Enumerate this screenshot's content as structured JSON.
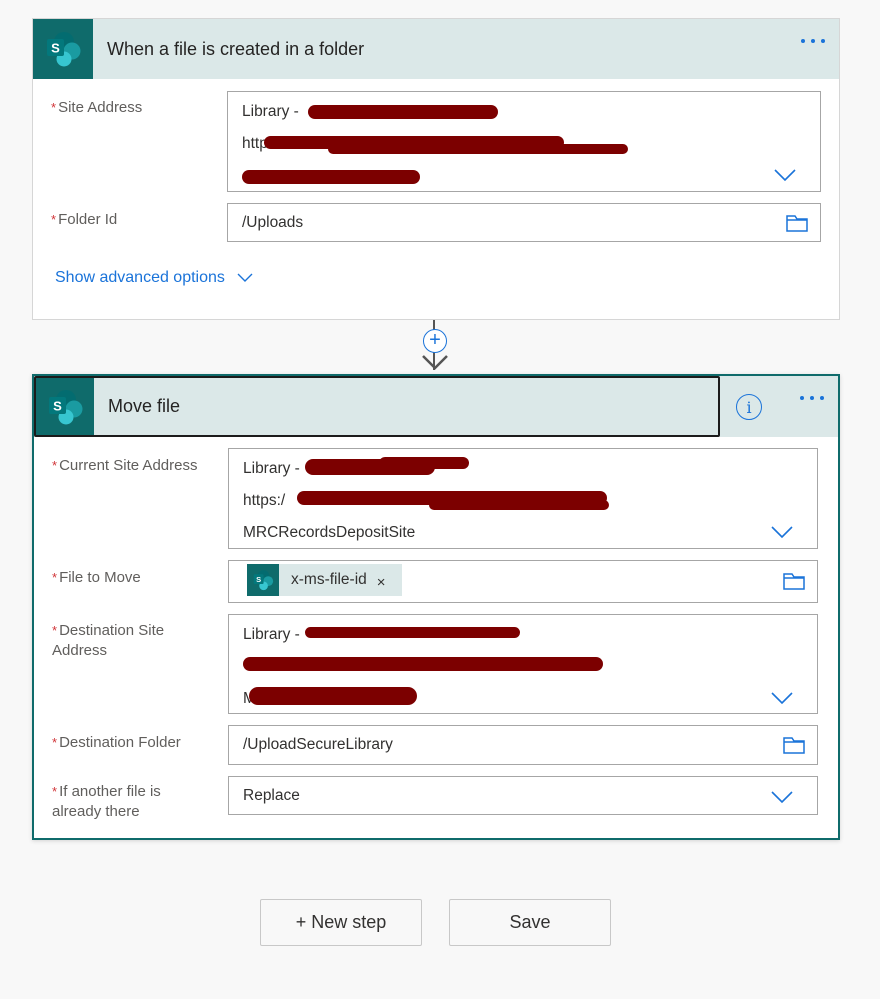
{
  "trigger": {
    "title": "When a file is created in a folder",
    "icon": "sharepoint-icon",
    "fields": {
      "site_address": {
        "label": "Site Address",
        "lines": [
          "Library - ",
          "http",
          ""
        ]
      },
      "folder_id": {
        "label": "Folder Id",
        "value": "/Uploads"
      }
    },
    "advanced_label": "Show advanced options"
  },
  "connector": {
    "plus_label": "+"
  },
  "action": {
    "title": "Move file",
    "icon": "sharepoint-icon",
    "info_label": "i",
    "fields": {
      "current_site": {
        "label": "Current Site Address",
        "lines": [
          "Library - ",
          "https:/",
          "MRCRecordsDepositSite"
        ]
      },
      "file_to_move": {
        "label": "File to Move",
        "token": "x-ms-file-id",
        "token_close": "×"
      },
      "destination_site": {
        "label_line1": "Destination Site",
        "label_line2": "Address",
        "lines": [
          "Library - ",
          "",
          "M"
        ]
      },
      "destination_folder": {
        "label": "Destination Folder",
        "value": "/UploadSecureLibrary"
      },
      "if_exists": {
        "label_line1": "If another file is",
        "label_line2": "already there",
        "value": "Replace"
      }
    }
  },
  "required_marker": "*",
  "footer": {
    "new_step_label": "+ New step",
    "save_label": "Save"
  },
  "colors": {
    "brand_teal": "#0f6b6b",
    "header_bg": "#dbe8e8",
    "accent_blue": "#1a73d9",
    "required_red": "#d13438",
    "redaction": "#7c0000"
  }
}
